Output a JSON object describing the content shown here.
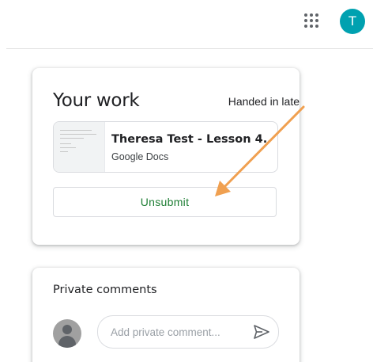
{
  "topbar": {
    "apps_icon": "apps-grid-icon",
    "avatar_letter": "T",
    "avatar_color": "#00a1b0"
  },
  "work": {
    "title": "Your work",
    "status": "Handed in late",
    "attachment": {
      "title": "Theresa Test - Lesson 4...",
      "type": "Google Docs"
    },
    "unsubmit_label": "Unsubmit",
    "unsubmit_color": "#1e7e34"
  },
  "comments": {
    "title": "Private comments",
    "placeholder": "Add private comment...",
    "send_icon": "send-icon"
  },
  "annotation": {
    "arrow_color": "#f0a050"
  }
}
